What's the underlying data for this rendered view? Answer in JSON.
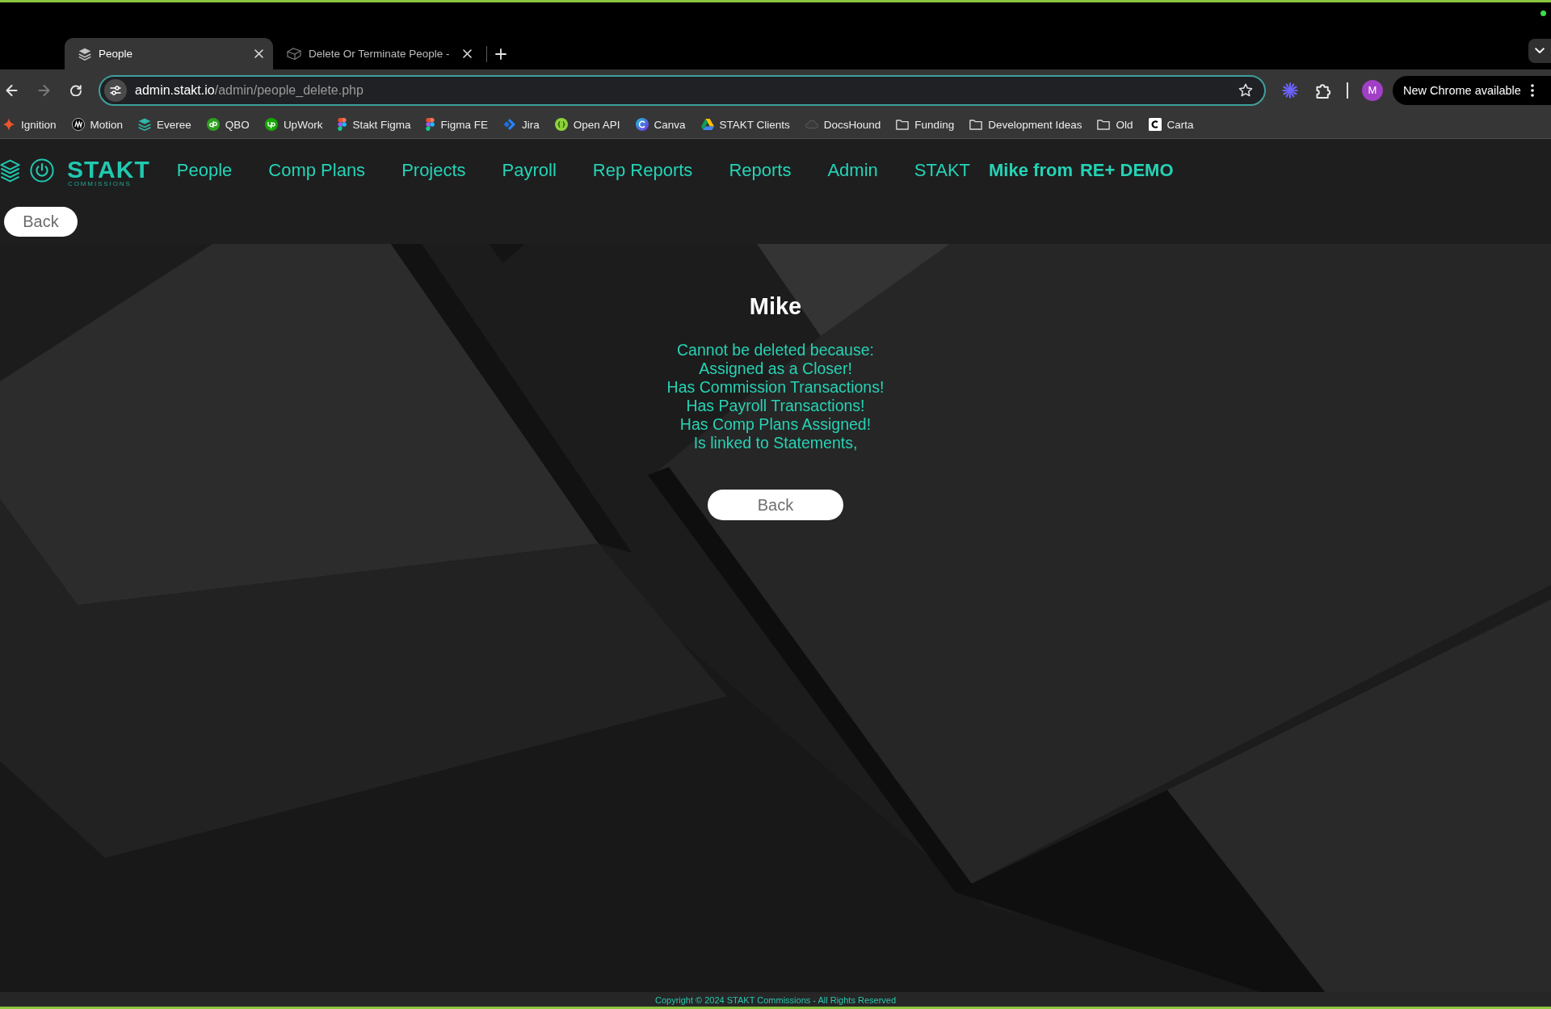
{
  "browser": {
    "tabs": [
      {
        "title": "People",
        "selected": true
      },
      {
        "title": "Delete Or Terminate People -",
        "selected": false
      }
    ],
    "address": {
      "host": "admin.stakt.io",
      "path": "/admin/people_delete.php"
    },
    "profile_initial": "M",
    "update_button": "New Chrome available",
    "bookmarks": [
      {
        "label": "Ignition",
        "kind": "site"
      },
      {
        "label": "Motion",
        "kind": "site"
      },
      {
        "label": "Everee",
        "kind": "site"
      },
      {
        "label": "QBO",
        "kind": "site"
      },
      {
        "label": "UpWork",
        "kind": "site"
      },
      {
        "label": "Stakt Figma",
        "kind": "site"
      },
      {
        "label": "Figma FE",
        "kind": "site"
      },
      {
        "label": "Jira",
        "kind": "site"
      },
      {
        "label": "Open API",
        "kind": "site"
      },
      {
        "label": "Canva",
        "kind": "site"
      },
      {
        "label": "STAKT Clients",
        "kind": "site"
      },
      {
        "label": "DocsHound",
        "kind": "site"
      },
      {
        "label": "Funding",
        "kind": "folder"
      },
      {
        "label": "Development Ideas",
        "kind": "folder"
      },
      {
        "label": "Old",
        "kind": "folder"
      },
      {
        "label": "Carta",
        "kind": "site"
      }
    ]
  },
  "app": {
    "logo": {
      "wordmark": "STAKT",
      "tagline": "COMMISSIONS"
    },
    "nav": [
      "People",
      "Comp Plans",
      "Projects",
      "Payroll",
      "Rep Reports",
      "Reports",
      "Admin",
      "STAKT"
    ],
    "user": {
      "name": "Mike from",
      "company": "RE+ DEMO"
    },
    "back_button": "Back"
  },
  "notice": {
    "person": "Mike",
    "heading": "Cannot be deleted because:",
    "reasons": [
      "Assigned as a Closer!",
      "Has Commission Transactions!",
      "Has Payroll Transactions!",
      "Has Comp Plans Assigned!",
      "Is linked to Statements,"
    ],
    "back_button": "Back"
  },
  "footer": {
    "copyright": "Copyright © 2024 STAKT Commissions - All Rights Reserved"
  }
}
